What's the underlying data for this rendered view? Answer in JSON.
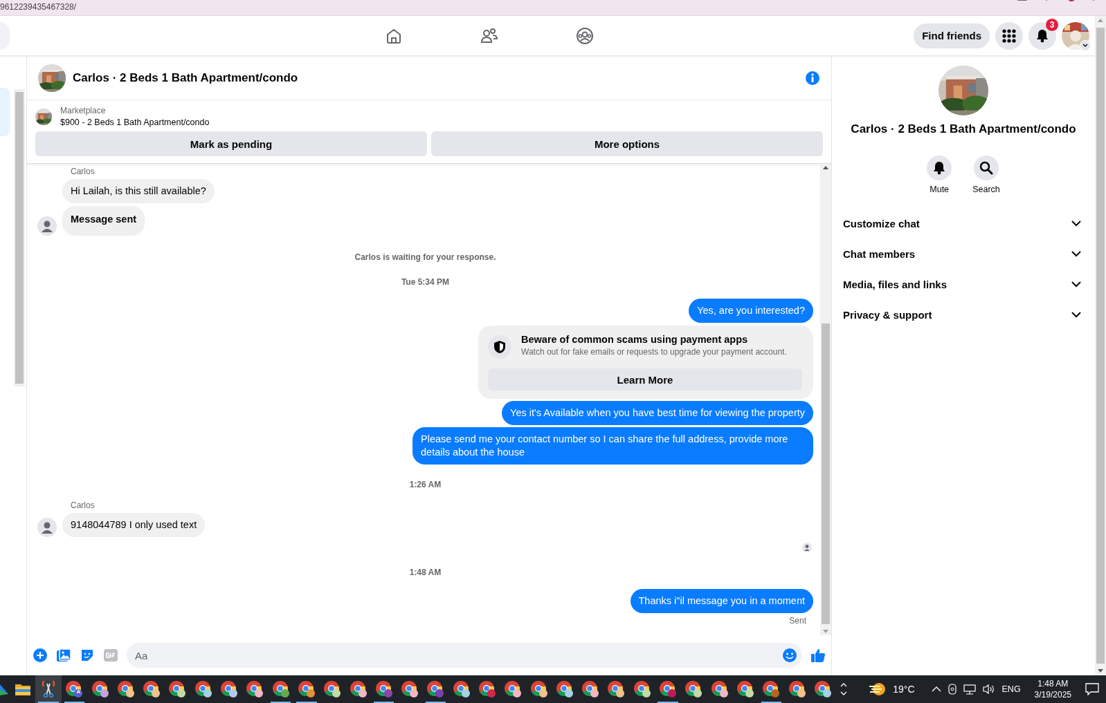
{
  "browser": {
    "url": "9612239435467328/"
  },
  "topbar": {
    "find_friends": "Find friends",
    "notification_count": "3"
  },
  "chat": {
    "title": "Carlos · 2 Beds 1 Bath Apartment/condo",
    "listing": {
      "source": "Marketplace",
      "text": "$900 - 2 Beds 1 Bath Apartment/condo"
    },
    "actions": [
      "Mark as pending",
      "More options"
    ],
    "messages": [
      {
        "kind": "name",
        "text": "Carlos"
      },
      {
        "kind": "incoming",
        "text": "Hi Lailah, is this still available?",
        "avatar": false,
        "bold": false
      },
      {
        "kind": "incoming",
        "text": "Message sent",
        "avatar": true,
        "bold": true
      },
      {
        "kind": "notice",
        "text": "Carlos is waiting for your response."
      },
      {
        "kind": "time",
        "text": "Tue 5:34 PM"
      },
      {
        "kind": "outgoing",
        "text": "Yes, are you interested?"
      },
      {
        "kind": "warning",
        "title": "Beware of common scams using payment apps",
        "text": "Watch out for fake emails or requests to upgrade your payment account.",
        "button": "Learn More"
      },
      {
        "kind": "outgoing",
        "text": "Yes it's Available when you have best time for viewing the property"
      },
      {
        "kind": "outgoing",
        "text": "Please send me your contact number so I can share the full address, provide more details about the house"
      },
      {
        "kind": "time",
        "text": "1:26 AM"
      },
      {
        "kind": "name",
        "text": "Carlos"
      },
      {
        "kind": "incoming",
        "text": "9148044789 I only used text",
        "avatar": true,
        "bold": false
      },
      {
        "kind": "seen"
      },
      {
        "kind": "time",
        "text": "1:48 AM"
      },
      {
        "kind": "outgoing",
        "text": "Thanks i\"il message you in a moment"
      },
      {
        "kind": "status",
        "text": "Sent"
      }
    ],
    "composer": {
      "placeholder": "Aa"
    }
  },
  "info_panel": {
    "title": "Carlos · 2 Beds 1 Bath Apartment/condo",
    "actions": [
      {
        "kind": "bell",
        "label": "Mute"
      },
      {
        "kind": "search",
        "label": "Search"
      }
    ],
    "sections": [
      "Customize chat",
      "Chat members",
      "Media, files and links",
      "Privacy & support"
    ]
  },
  "taskbar": {
    "apps": [
      {
        "kind": "drive",
        "running": false
      },
      {
        "kind": "folder",
        "running": false
      },
      {
        "kind": "snip",
        "running": true
      },
      {
        "kind": "browser",
        "running": true,
        "badge": "A",
        "color": "#5b5fd0"
      },
      {
        "kind": "browser",
        "running": false,
        "color": "#c9a0dc"
      },
      {
        "kind": "browser",
        "running": false,
        "color": "#f2c18d"
      },
      {
        "kind": "browser",
        "running": false,
        "color": "#f2c18d"
      },
      {
        "kind": "browser",
        "running": false,
        "color": "#c5d9a6"
      },
      {
        "kind": "browser",
        "running": false,
        "color": "#a6d0e4"
      },
      {
        "kind": "browser",
        "running": false,
        "color": "#b7c8ef"
      },
      {
        "kind": "browser",
        "running": false,
        "color": "#f4b6c2"
      },
      {
        "kind": "browser",
        "running": true,
        "color": "#6aa84f"
      },
      {
        "kind": "browser",
        "running": true,
        "color": "#e69138"
      },
      {
        "kind": "browser",
        "running": false,
        "color": "#c5d9a6"
      },
      {
        "kind": "browser",
        "running": false,
        "color": "#f4b6c2"
      },
      {
        "kind": "browser",
        "running": true,
        "color": "#8e44ad"
      },
      {
        "kind": "browser",
        "running": false,
        "color": "#f4b6c2"
      },
      {
        "kind": "browser",
        "running": true,
        "color": "#7b3fb5"
      },
      {
        "kind": "browser",
        "running": false,
        "color": "#a6d0e4"
      },
      {
        "kind": "browser",
        "running": false,
        "color": "#d6244d"
      },
      {
        "kind": "browser",
        "running": false,
        "color": "#f4b6c2"
      },
      {
        "kind": "browser",
        "running": false,
        "color": "#f2c18d"
      },
      {
        "kind": "browser",
        "running": false,
        "color": "#a6d0e4"
      },
      {
        "kind": "browser",
        "running": false,
        "color": "#f4b6c2"
      },
      {
        "kind": "browser",
        "running": false,
        "color": "#f2c18d"
      },
      {
        "kind": "browser",
        "running": false,
        "color": "#c5d9a6"
      },
      {
        "kind": "browser",
        "running": true,
        "color": "#c2185b"
      },
      {
        "kind": "browser",
        "running": false,
        "color": "#c5d9a6"
      },
      {
        "kind": "browser",
        "running": false,
        "color": "#f4b6c2"
      },
      {
        "kind": "browser",
        "running": false,
        "color": "#c5d9a6"
      },
      {
        "kind": "browser",
        "running": true,
        "color": "#b8651b"
      },
      {
        "kind": "browser",
        "running": false,
        "color": "#f2c18d"
      },
      {
        "kind": "browser",
        "running": false,
        "color": "#a6d0e4"
      }
    ],
    "temperature": "19°C",
    "language": "ENG",
    "time": "1:48 AM",
    "date": "3/19/2025"
  }
}
